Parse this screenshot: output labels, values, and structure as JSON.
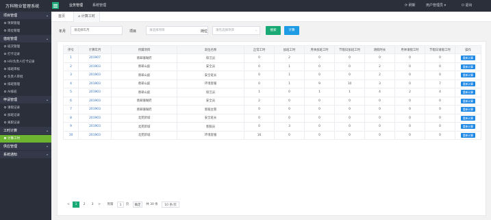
{
  "app": {
    "title": "万科物业管理系统"
  },
  "top_nav": [
    {
      "label": "业务管理"
    },
    {
      "label": "系统管理"
    }
  ],
  "top_right": {
    "refresh": "刷新",
    "user": "用户管理员",
    "logout": "退出"
  },
  "sidebar": {
    "sections": [
      {
        "label": "项目管理",
        "items": [
          {
            "label": "项目管理"
          },
          {
            "label": "岗位管理"
          }
        ]
      },
      {
        "label": "值班管理",
        "items": [
          {
            "label": "班次管理"
          },
          {
            "label": "打卡记录"
          },
          {
            "label": "HR/负责人打卡记录"
          },
          {
            "label": "排班审核"
          },
          {
            "label": "负责人审批"
          },
          {
            "label": "排班管理"
          },
          {
            "label": "AI排班"
          }
        ]
      },
      {
        "label": "申请管理",
        "items": [
          {
            "label": "请假记录"
          },
          {
            "label": "加班记录"
          },
          {
            "label": "离职记录"
          }
        ]
      },
      {
        "label": "工时计算",
        "items": [
          {
            "label": "计算工时",
            "active": true
          }
        ]
      },
      {
        "label": "供应管理",
        "items": []
      },
      {
        "label": "系统通知",
        "items": []
      }
    ]
  },
  "tabs": [
    {
      "label": "首页"
    },
    {
      "label": "计算工时"
    }
  ],
  "filters": {
    "month_label": "年月",
    "month_placeholder": "请选择年月",
    "project_label": "项目",
    "project_placeholder": "请选择项目",
    "position_label": "岗位",
    "position_placeholder": "请先选择项目",
    "search_button": "搜索",
    "calc_button": "计算"
  },
  "table": {
    "headers": [
      "序号",
      "计算年月",
      "所属项目",
      "岗位名称",
      "正常工时",
      "加班工时",
      "月休加班工时",
      "节假日加班工时",
      "请假时长",
      "月休请假工时",
      "节假日请假工时",
      "操作"
    ],
    "rows": [
      [
        "1",
        "201907",
        "翡翠珊瑚府",
        "保洁员",
        "0",
        "2",
        "0",
        "0",
        "0",
        "0",
        "0",
        "重新计算"
      ],
      [
        "2",
        "201903",
        "翡翠山庭",
        "安全员",
        "0",
        "1",
        "0",
        "0",
        "2",
        "0",
        "0",
        "重新计算"
      ],
      [
        "3",
        "201903",
        "翡翠山庭",
        "安全班长",
        "0",
        "1",
        "0",
        "0",
        "2",
        "0",
        "0",
        "重新计算"
      ],
      [
        "4",
        "201903",
        "翡翠山庭",
        "环境客服",
        "0",
        "1",
        "9",
        "10",
        "3",
        "0",
        "7",
        "重新计算"
      ],
      [
        "5",
        "201903",
        "翡翠山庭",
        "保洁员",
        "1",
        "0",
        "1",
        "1",
        "4",
        "2",
        "4",
        "重新计算"
      ],
      [
        "6",
        "201903",
        "翡翠珊瑚府",
        "安全员",
        "2",
        "0",
        "0",
        "0",
        "0",
        "0",
        "0",
        "重新计算"
      ],
      [
        "7",
        "201903",
        "翡翠珊瑚府",
        "客服主管",
        "0",
        "0",
        "0",
        "0",
        "0",
        "0",
        "0",
        "重新计算"
      ],
      [
        "8",
        "201903",
        "北苑新城",
        "安全班长",
        "0",
        "0",
        "0",
        "0",
        "0",
        "0",
        "0",
        "重新计算"
      ],
      [
        "9",
        "201903",
        "北苑新城",
        "客服员",
        "0",
        "3",
        "0",
        "0",
        "0",
        "0",
        "0",
        "重新计算"
      ],
      [
        "10",
        "201903",
        "北苑新城",
        "环境客服",
        "16",
        "0",
        "0",
        "0",
        "0",
        "0",
        "0",
        "重新计算"
      ]
    ]
  },
  "pagination": {
    "pages": [
      "1",
      "2",
      "3"
    ],
    "prev": "<",
    "next": ">",
    "goto_label": "到第",
    "goto_value": "1",
    "page_unit": "页",
    "confirm": "确定",
    "total": "共 30 条",
    "page_size": "10 条/页"
  },
  "colors": {
    "accent": "#19a974",
    "sidebar_bg": "#2b2f3a",
    "active_item": "#6db531",
    "link": "#2f6fbe",
    "action_button": "#1e88e5"
  }
}
